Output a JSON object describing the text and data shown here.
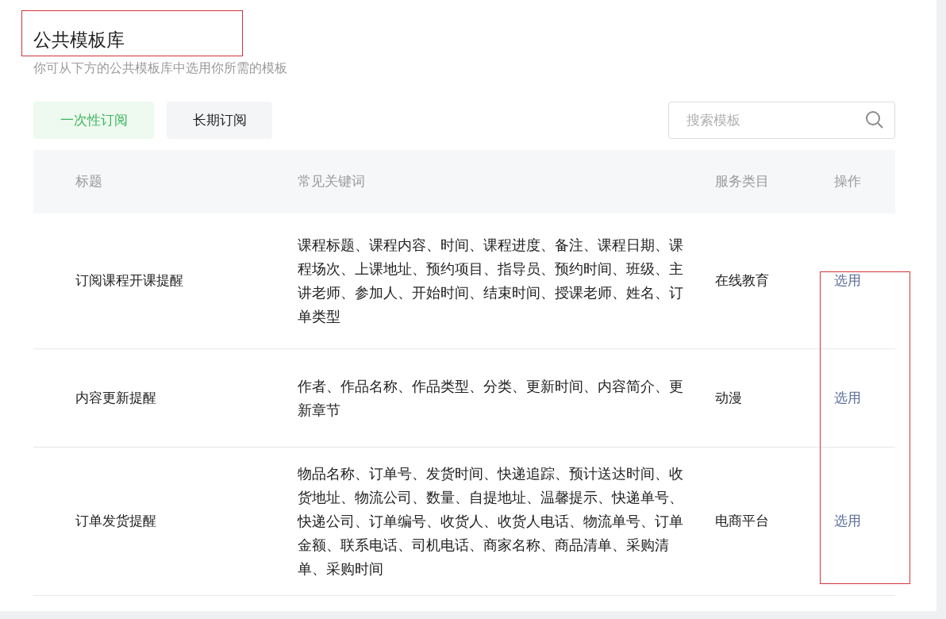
{
  "header": {
    "title": "公共模板库",
    "title_highlighted": true,
    "subtitle": "你可从下方的公共模板库中选用你所需的模板"
  },
  "tabs": [
    {
      "label": "一次性订阅",
      "selected": true
    },
    {
      "label": "长期订阅",
      "selected": false
    }
  ],
  "search": {
    "placeholder": "搜索模板"
  },
  "table": {
    "columns": [
      "标题",
      "常见关键词",
      "服务类目",
      "操作"
    ],
    "action_column_highlighted": true,
    "rows": [
      {
        "title": "订阅课程开课提醒",
        "keywords": "课程标题、课程内容、时间、课程进度、备注、课程日期、课程场次、上课地址、预约项目、指导员、预约时间、班级、主讲老师、参加人、开始时间、结束时间、授课老师、姓名、订单类型",
        "category": "在线教育",
        "action": "选用"
      },
      {
        "title": "内容更新提醒",
        "keywords": "作者、作品名称、作品类型、分类、更新时间、内容简介、更新章节",
        "category": "动漫",
        "action": "选用"
      },
      {
        "title": "订单发货提醒",
        "keywords": "物品名称、订单号、发货时间、快递追踪、预计送达时间、收货地址、物流公司、数量、自提地址、温馨提示、快递单号、快递公司、订单编号、收货人、收货人电话、物流单号、订单金额、联系电话、司机电话、商家名称、商品清单、采购清单、采购时间",
        "category": "电商平台",
        "action": "选用"
      }
    ]
  }
}
